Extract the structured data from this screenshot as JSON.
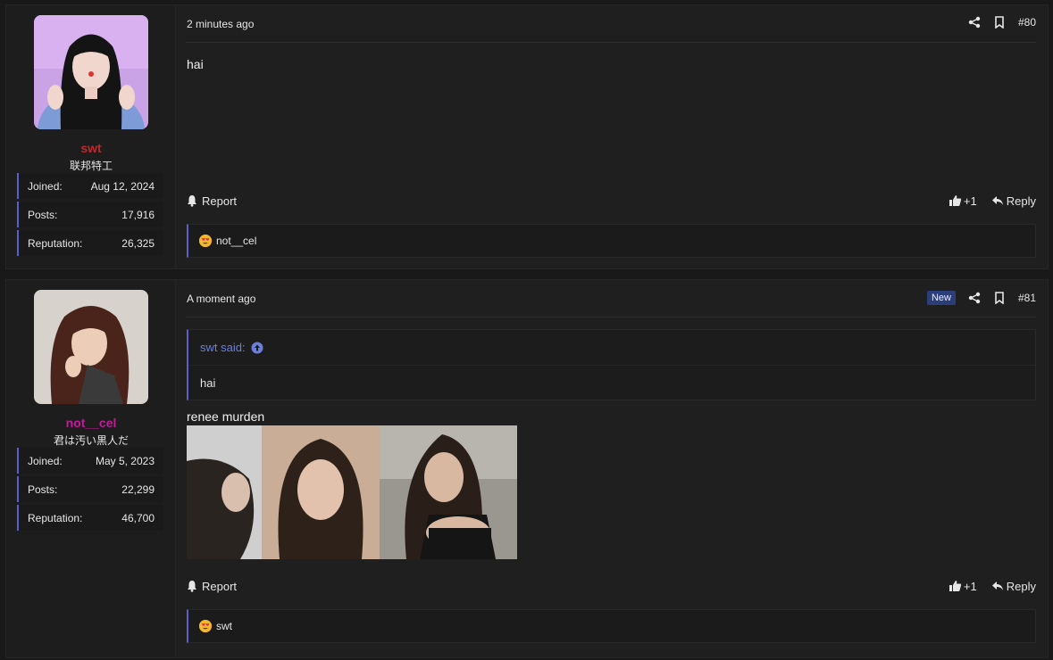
{
  "posts": [
    {
      "user": {
        "name": "swt",
        "name_color": "#c0282d",
        "title": "联邦特工",
        "stats": [
          {
            "label": "Joined:",
            "value": "Aug 12, 2024"
          },
          {
            "label": "Posts:",
            "value": "17,916"
          },
          {
            "label": "Reputation:",
            "value": "26,325"
          }
        ]
      },
      "time": "2 minutes ago",
      "post_number": "#80",
      "body": "hai",
      "footer": {
        "report": "Report",
        "like_count": "+1",
        "reply": "Reply"
      },
      "reactions": {
        "users": "not__cel"
      }
    },
    {
      "user": {
        "name": "not__cel",
        "name_color": "#c21a9a",
        "title": "君は汚い黒人だ",
        "stats": [
          {
            "label": "Joined:",
            "value": "May 5, 2023"
          },
          {
            "label": "Posts:",
            "value": "22,299"
          },
          {
            "label": "Reputation:",
            "value": "46,700"
          }
        ]
      },
      "time": "A moment ago",
      "badge": "New",
      "post_number": "#81",
      "quote": {
        "author": "swt said:",
        "text": "hai"
      },
      "body": "renee murden",
      "footer": {
        "report": "Report",
        "like_count": "+1",
        "reply": "Reply"
      },
      "reactions": {
        "users": "swt"
      }
    }
  ],
  "icons": {
    "share": "share-icon",
    "bookmark": "bookmark-icon",
    "bell": "bell-icon",
    "thumbs_up": "thumbs-up-icon",
    "reply": "reply-icon",
    "arrow_up": "arrow-up-circle-icon",
    "emoji": "heart-eyes-emoji-icon"
  },
  "colors": {
    "accent": "#5b5fc7",
    "quote_link": "#6b7fd8",
    "badge_new": "#2c3e7a"
  }
}
